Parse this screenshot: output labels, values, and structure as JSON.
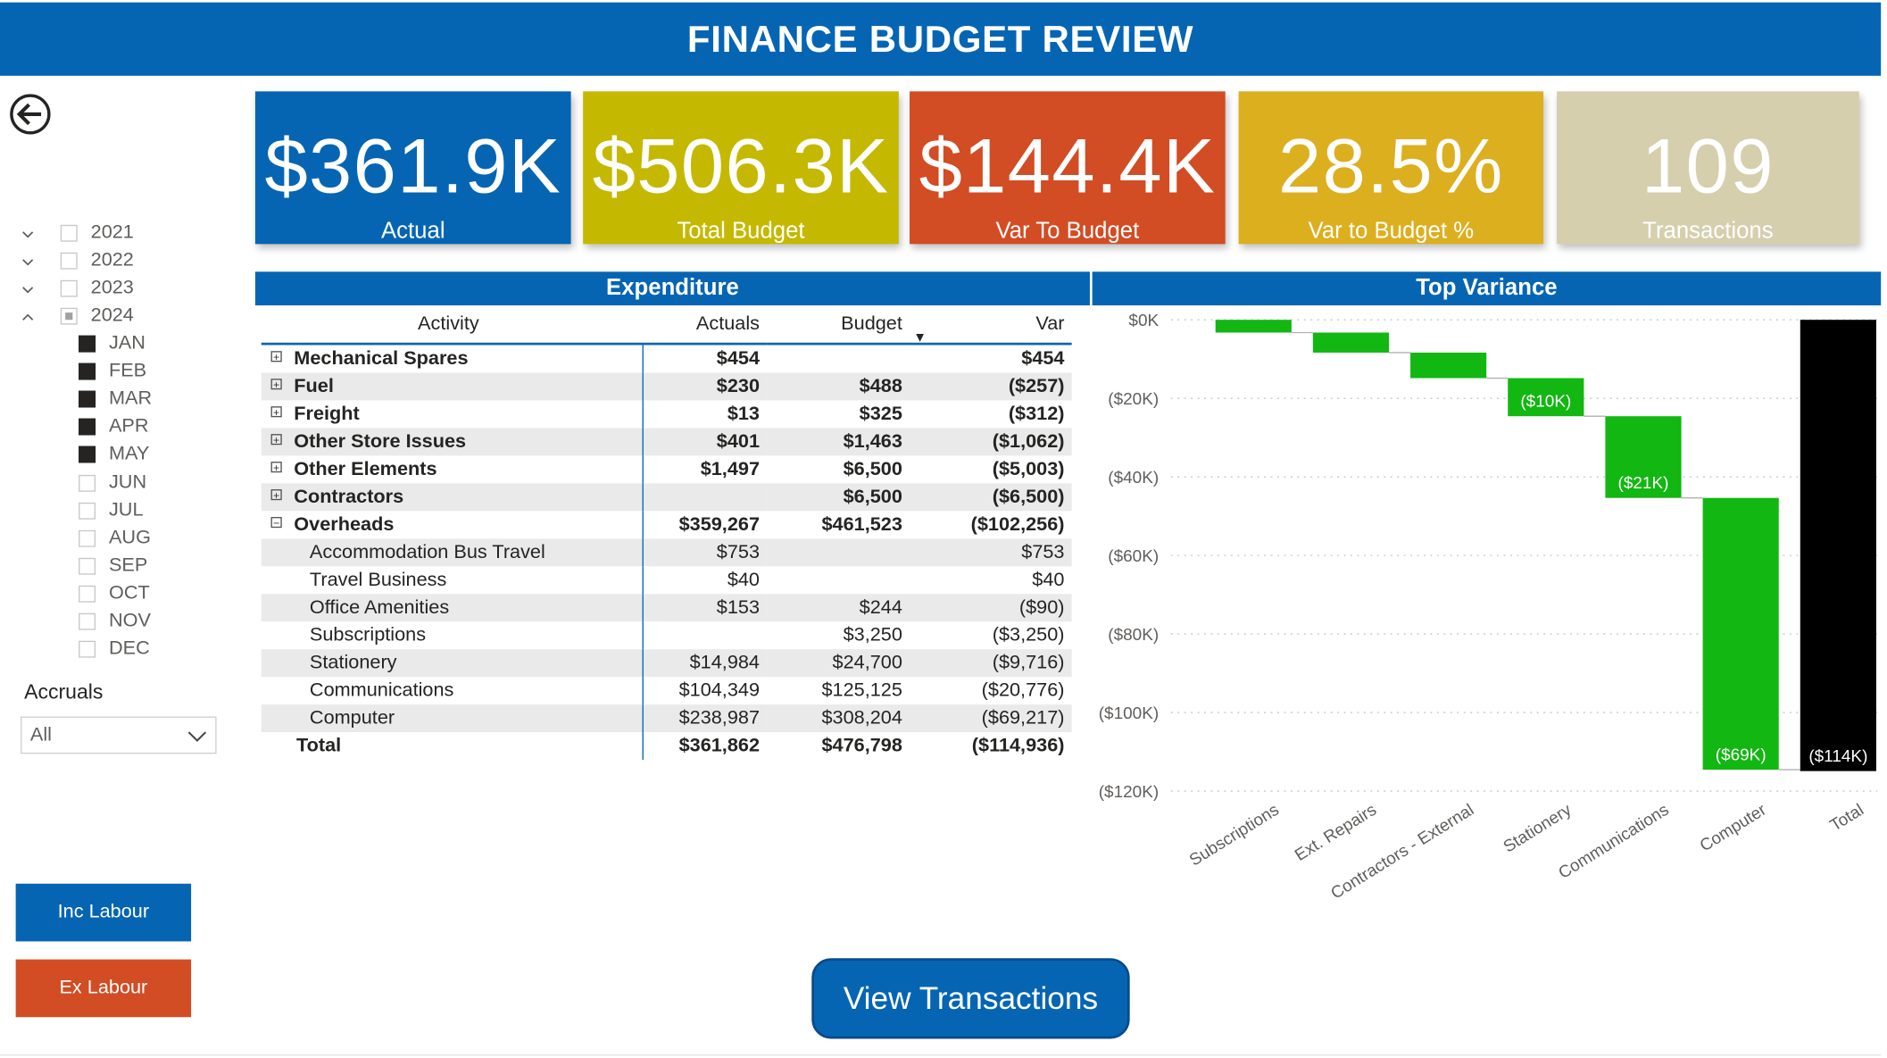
{
  "header": {
    "title": "FINANCE BUDGET REVIEW"
  },
  "kpis": [
    {
      "value": "$361.9K",
      "label": "Actual",
      "color": "#0565b3"
    },
    {
      "value": "$506.3K",
      "label": "Total Budget",
      "color": "#c4b900"
    },
    {
      "value": "$144.4K",
      "label": "Var To Budget",
      "color": "#d24c24"
    },
    {
      "value": "28.5%",
      "label": "Var to Budget %",
      "color": "#dcaf1f"
    },
    {
      "value": "109",
      "label": "Transactions",
      "color": "#d6cfae"
    }
  ],
  "date_slicer": {
    "years": [
      {
        "label": "2021",
        "state": "unchecked",
        "expanded": false
      },
      {
        "label": "2022",
        "state": "unchecked",
        "expanded": false
      },
      {
        "label": "2023",
        "state": "unchecked",
        "expanded": false
      },
      {
        "label": "2024",
        "state": "partial",
        "expanded": true
      }
    ],
    "months": [
      {
        "label": "JAN",
        "checked": true
      },
      {
        "label": "FEB",
        "checked": true
      },
      {
        "label": "MAR",
        "checked": true
      },
      {
        "label": "APR",
        "checked": true
      },
      {
        "label": "MAY",
        "checked": true
      },
      {
        "label": "JUN",
        "checked": false
      },
      {
        "label": "JUL",
        "checked": false
      },
      {
        "label": "AUG",
        "checked": false
      },
      {
        "label": "SEP",
        "checked": false
      },
      {
        "label": "OCT",
        "checked": false
      },
      {
        "label": "NOV",
        "checked": false
      },
      {
        "label": "DEC",
        "checked": false
      }
    ]
  },
  "accruals": {
    "title": "Accruals",
    "selected": "All"
  },
  "buttons": {
    "inc_labour": "Inc Labour",
    "ex_labour": "Ex Labour",
    "view_transactions": "View Transactions"
  },
  "expenditure": {
    "title": "Expenditure",
    "columns": [
      "Activity",
      "Actuals",
      "Budget",
      "Var"
    ],
    "sort_column": "Budget",
    "rows": [
      {
        "level": 0,
        "expand": "+",
        "activity": "Mechanical Spares",
        "actuals": "$454",
        "budget": "",
        "var": "$454"
      },
      {
        "level": 0,
        "expand": "+",
        "activity": "Fuel",
        "actuals": "$230",
        "budget": "$488",
        "var": "($257)"
      },
      {
        "level": 0,
        "expand": "+",
        "activity": "Freight",
        "actuals": "$13",
        "budget": "$325",
        "var": "($312)"
      },
      {
        "level": 0,
        "expand": "+",
        "activity": "Other Store Issues",
        "actuals": "$401",
        "budget": "$1,463",
        "var": "($1,062)"
      },
      {
        "level": 0,
        "expand": "+",
        "activity": "Other Elements",
        "actuals": "$1,497",
        "budget": "$6,500",
        "var": "($5,003)"
      },
      {
        "level": 0,
        "expand": "+",
        "activity": "Contractors",
        "actuals": "",
        "budget": "$6,500",
        "var": "($6,500)"
      },
      {
        "level": 0,
        "expand": "-",
        "activity": "Overheads",
        "actuals": "$359,267",
        "budget": "$461,523",
        "var": "($102,256)"
      },
      {
        "level": 1,
        "expand": "",
        "activity": "Accommodation Bus Travel",
        "actuals": "$753",
        "budget": "",
        "var": "$753"
      },
      {
        "level": 1,
        "expand": "",
        "activity": "Travel Business",
        "actuals": "$40",
        "budget": "",
        "var": "$40"
      },
      {
        "level": 1,
        "expand": "",
        "activity": "Office Amenities",
        "actuals": "$153",
        "budget": "$244",
        "var": "($90)"
      },
      {
        "level": 1,
        "expand": "",
        "activity": "Subscriptions",
        "actuals": "",
        "budget": "$3,250",
        "var": "($3,250)"
      },
      {
        "level": 1,
        "expand": "",
        "activity": "Stationery",
        "actuals": "$14,984",
        "budget": "$24,700",
        "var": "($9,716)"
      },
      {
        "level": 1,
        "expand": "",
        "activity": "Communications",
        "actuals": "$104,349",
        "budget": "$125,125",
        "var": "($20,776)"
      },
      {
        "level": 1,
        "expand": "",
        "activity": "Computer",
        "actuals": "$238,987",
        "budget": "$308,204",
        "var": "($69,217)"
      }
    ],
    "total": {
      "activity": "Total",
      "actuals": "$361,862",
      "budget": "$476,798",
      "var": "($114,936)"
    }
  },
  "chart_data": {
    "type": "waterfall",
    "title": "Top Variance",
    "categories": [
      "Subscriptions",
      "Ext. Repairs",
      "Contractors - External",
      "Stationery",
      "Communications",
      "Computer",
      "Total"
    ],
    "values": [
      -3.25,
      -5.1,
      -6.5,
      -9.7,
      -20.8,
      -69.2,
      -114.9
    ],
    "is_total": [
      false,
      false,
      false,
      false,
      false,
      false,
      true
    ],
    "data_labels": [
      "",
      "",
      "",
      "($10K)",
      "($21K)",
      "($69K)",
      "($114K)"
    ],
    "y_ticks": [
      "$0K",
      "($20K)",
      "($40K)",
      "($60K)",
      "($80K)",
      "($100K)",
      "($120K)"
    ],
    "ylim": [
      -120,
      0
    ],
    "colors": {
      "bar": "#12b712",
      "total": "#000000",
      "grid": "#c8c8c8"
    }
  }
}
